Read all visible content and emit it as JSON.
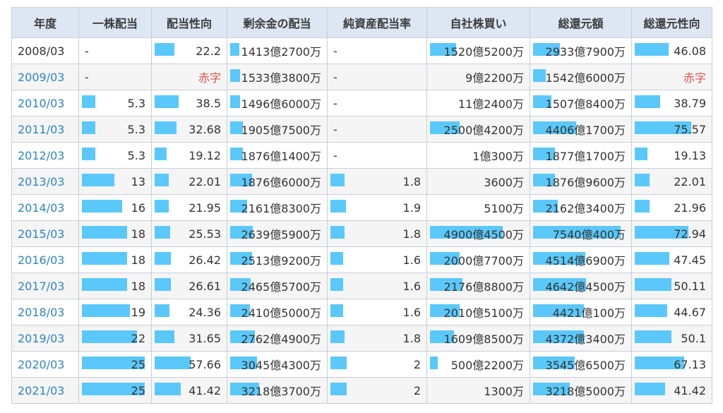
{
  "headers": [
    "年度",
    "一株配当",
    "配当性向",
    "剰余金の配当",
    "純資産配当率",
    "自社株買い",
    "総還元額",
    "総還元性向"
  ],
  "colors": {
    "bar": "#5ac8fa",
    "link": "#2e86c1",
    "deficit": "#e0514b",
    "header_bg": "#dde6f3"
  },
  "rows": [
    {
      "year": "2008/03",
      "link": false,
      "cells": [
        {
          "text": "-",
          "bar": null
        },
        {
          "text": "22.2",
          "bar": 0.3
        },
        {
          "text": "1413億2700万",
          "bar": 0.1
        },
        {
          "text": "-",
          "bar": null
        },
        {
          "text": "1520億5200万",
          "bar": 0.28
        },
        {
          "text": "2933億7900万",
          "bar": 0.29
        },
        {
          "text": "46.08",
          "bar": 0.48
        }
      ]
    },
    {
      "year": "2009/03",
      "link": true,
      "cells": [
        {
          "text": "-",
          "bar": null
        },
        {
          "text": "赤字",
          "bar": null,
          "deficit": true
        },
        {
          "text": "1533億3800万",
          "bar": 0.11
        },
        {
          "text": "-",
          "bar": null
        },
        {
          "text": "9億2200万",
          "bar": 0
        },
        {
          "text": "1542億6000万",
          "bar": 0.14
        },
        {
          "text": "赤字",
          "bar": null,
          "deficit": true
        }
      ]
    },
    {
      "year": "2010/03",
      "link": true,
      "cells": [
        {
          "text": "5.3",
          "bar": 0.21
        },
        {
          "text": "38.5",
          "bar": 0.37
        },
        {
          "text": "1496億6000万",
          "bar": 0.11
        },
        {
          "text": "-",
          "bar": null
        },
        {
          "text": "11億2400万",
          "bar": 0
        },
        {
          "text": "1507億8400万",
          "bar": 0.2
        },
        {
          "text": "38.79",
          "bar": 0.36
        }
      ]
    },
    {
      "year": "2011/03",
      "link": true,
      "cells": [
        {
          "text": "5.3",
          "bar": 0.21
        },
        {
          "text": "32.68",
          "bar": 0.33
        },
        {
          "text": "1905億7500万",
          "bar": 0.14
        },
        {
          "text": "-",
          "bar": null
        },
        {
          "text": "2500億4200万",
          "bar": 0.32
        },
        {
          "text": "4406億1700万",
          "bar": 0.47
        },
        {
          "text": "75.57",
          "bar": 0.8
        }
      ]
    },
    {
      "year": "2012/03",
      "link": true,
      "cells": [
        {
          "text": "5.3",
          "bar": 0.21
        },
        {
          "text": "19.12",
          "bar": 0.18
        },
        {
          "text": "1876億1400万",
          "bar": 0.14
        },
        {
          "text": "-",
          "bar": null
        },
        {
          "text": "1億300万",
          "bar": 0
        },
        {
          "text": "1877億1700万",
          "bar": 0.24
        },
        {
          "text": "19.13",
          "bar": 0.18
        }
      ]
    },
    {
      "year": "2013/03",
      "link": true,
      "cells": [
        {
          "text": "13",
          "bar": 0.52
        },
        {
          "text": "22.01",
          "bar": 0.21
        },
        {
          "text": "1876億6000万",
          "bar": 0.24
        },
        {
          "text": "1.8",
          "bar": 0.16
        },
        {
          "text": "3600万",
          "bar": 0
        },
        {
          "text": "1876億9600万",
          "bar": 0.24
        },
        {
          "text": "22.01",
          "bar": 0.21
        }
      ]
    },
    {
      "year": "2014/03",
      "link": true,
      "cells": [
        {
          "text": "16",
          "bar": 0.64
        },
        {
          "text": "21.95",
          "bar": 0.21
        },
        {
          "text": "2161億8300万",
          "bar": 0.19
        },
        {
          "text": "1.9",
          "bar": 0.17
        },
        {
          "text": "5100万",
          "bar": 0
        },
        {
          "text": "2162億3400万",
          "bar": 0.27
        },
        {
          "text": "21.96",
          "bar": 0.21
        }
      ]
    },
    {
      "year": "2015/03",
      "link": true,
      "cells": [
        {
          "text": "18",
          "bar": 0.72
        },
        {
          "text": "25.53",
          "bar": 0.24
        },
        {
          "text": "2639億5900万",
          "bar": 0.25
        },
        {
          "text": "1.8",
          "bar": 0.16
        },
        {
          "text": "4900億4500万",
          "bar": 0.78
        },
        {
          "text": "7540億400万",
          "bar": 0.95
        },
        {
          "text": "72.94",
          "bar": 0.76
        }
      ]
    },
    {
      "year": "2016/03",
      "link": true,
      "cells": [
        {
          "text": "18",
          "bar": 0.72
        },
        {
          "text": "26.42",
          "bar": 0.25
        },
        {
          "text": "2513億9200万",
          "bar": 0.24
        },
        {
          "text": "1.6",
          "bar": 0.14
        },
        {
          "text": "2000億7700万",
          "bar": 0.32
        },
        {
          "text": "4514億6900万",
          "bar": 0.57
        },
        {
          "text": "47.45",
          "bar": 0.49
        }
      ]
    },
    {
      "year": "2017/03",
      "link": true,
      "cells": [
        {
          "text": "18",
          "bar": 0.72
        },
        {
          "text": "26.61",
          "bar": 0.25
        },
        {
          "text": "2465億5700万",
          "bar": 0.23
        },
        {
          "text": "1.6",
          "bar": 0.14
        },
        {
          "text": "2176億8800万",
          "bar": 0.35
        },
        {
          "text": "4642億4500万",
          "bar": 0.58
        },
        {
          "text": "50.11",
          "bar": 0.52
        }
      ]
    },
    {
      "year": "2018/03",
      "link": true,
      "cells": [
        {
          "text": "19",
          "bar": 0.76
        },
        {
          "text": "24.36",
          "bar": 0.23
        },
        {
          "text": "2410億5000万",
          "bar": 0.22
        },
        {
          "text": "1.6",
          "bar": 0.14
        },
        {
          "text": "2010億5100万",
          "bar": 0.32
        },
        {
          "text": "4421億100万",
          "bar": 0.55
        },
        {
          "text": "44.67",
          "bar": 0.46
        }
      ]
    },
    {
      "year": "2019/03",
      "link": true,
      "cells": [
        {
          "text": "22",
          "bar": 0.88
        },
        {
          "text": "31.65",
          "bar": 0.3
        },
        {
          "text": "2762億4900万",
          "bar": 0.27
        },
        {
          "text": "1.8",
          "bar": 0.16
        },
        {
          "text": "1609億8500万",
          "bar": 0.26
        },
        {
          "text": "4372億3400万",
          "bar": 0.55
        },
        {
          "text": "50.1",
          "bar": 0.52
        }
      ]
    },
    {
      "year": "2020/03",
      "link": true,
      "cells": [
        {
          "text": "25",
          "bar": 1.0
        },
        {
          "text": "57.66",
          "bar": 0.55
        },
        {
          "text": "3045億4300万",
          "bar": 0.3
        },
        {
          "text": "2",
          "bar": 0.18
        },
        {
          "text": "500億2200万",
          "bar": 0.08
        },
        {
          "text": "3545億6500万",
          "bar": 0.45
        },
        {
          "text": "67.13",
          "bar": 0.7
        }
      ]
    },
    {
      "year": "2021/03",
      "link": true,
      "cells": [
        {
          "text": "25",
          "bar": 1.0
        },
        {
          "text": "41.42",
          "bar": 0.4
        },
        {
          "text": "3218億3700万",
          "bar": 0.32
        },
        {
          "text": "2",
          "bar": 0.18
        },
        {
          "text": "1300万",
          "bar": 0
        },
        {
          "text": "3218億5000万",
          "bar": 0.4
        },
        {
          "text": "41.42",
          "bar": 0.43
        }
      ]
    }
  ]
}
